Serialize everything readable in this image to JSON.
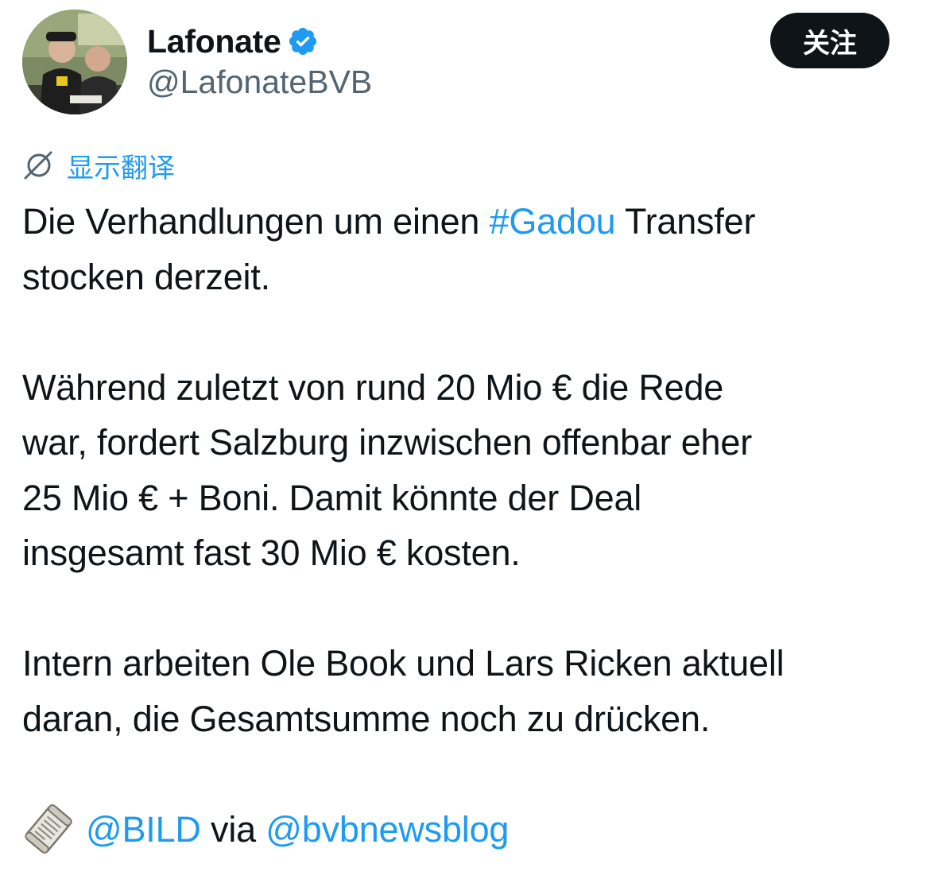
{
  "author": {
    "display_name": "Lafonate",
    "handle": "@LafonateBVB",
    "verified_icon": "verified-badge-icon",
    "verified_color": "#1d9bf0"
  },
  "follow_button": {
    "label": "关注"
  },
  "translate": {
    "label": "显示翻译",
    "icon": "translate-icon"
  },
  "tweet": {
    "para1": {
      "before": "Die Verhandlungen um einen ",
      "hashtag": "#Gadou",
      "after": " Transfer",
      "line2": "stocken derzeit."
    },
    "para2": {
      "line1": "Während zuletzt von rund 20 Mio € die Rede",
      "line2": "war, fordert Salzburg inzwischen offenbar eher",
      "line3": "25 Mio € + Boni. Damit könnte der Deal",
      "line4": "insgesamt fast 30 Mio € kosten."
    },
    "para3": {
      "line1": "Intern arbeiten Ole Book und Lars Ricken aktuell",
      "line2": "daran, die Gesamtsumme noch zu drücken."
    },
    "source": {
      "icon": "rolled-newspaper-icon",
      "mention1": "@BILD",
      "via": " via ",
      "mention2": "@bvbnewsblog"
    }
  },
  "colors": {
    "link": "#1d9bf0",
    "text": "#0f1419",
    "secondary": "#536471",
    "button_bg": "#0f1419"
  }
}
